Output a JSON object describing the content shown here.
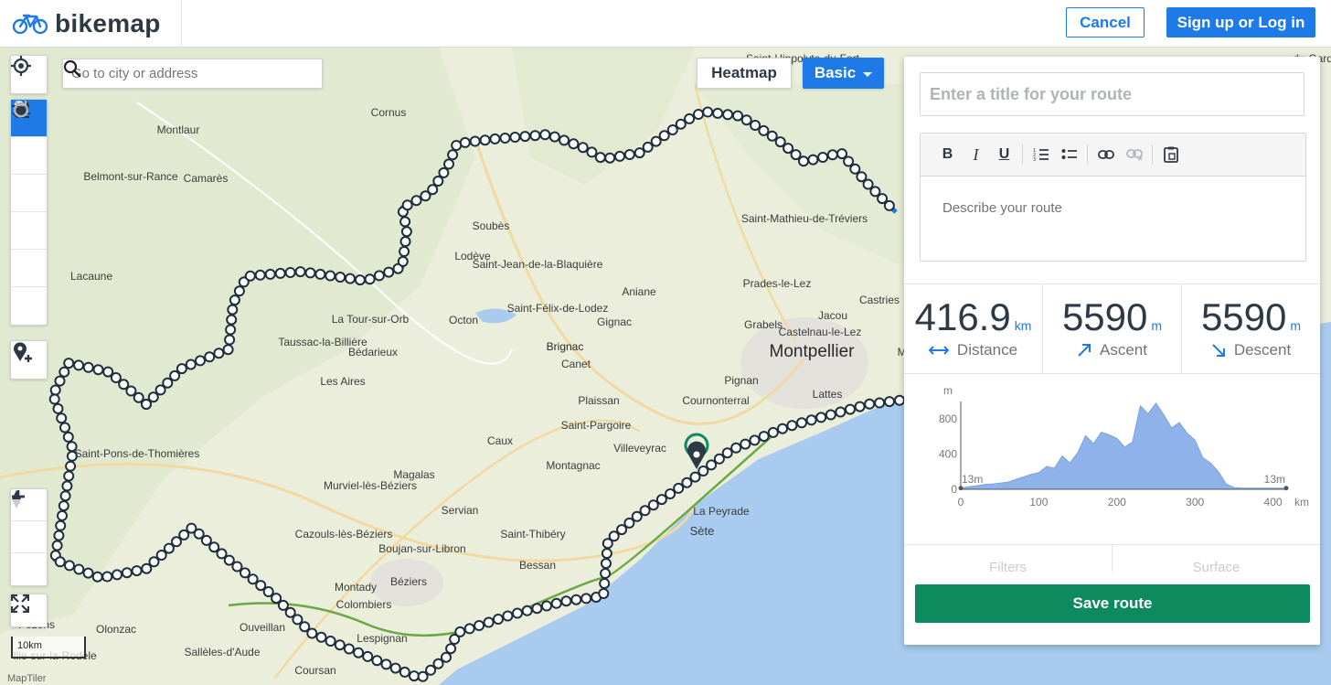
{
  "app": {
    "name": "bikemap"
  },
  "header": {
    "cancel_label": "Cancel",
    "signup_label": "Sign up or Log in"
  },
  "search": {
    "placeholder": "Go to city or address"
  },
  "map_layers": {
    "heatmap_label": "Heatmap",
    "basic_label": "Basic"
  },
  "map": {
    "scale_label": "10km",
    "attribution": "MapTiler",
    "places": [
      "Saint-Hippolyte-du-Fort",
      "Cornus",
      "Montlaur",
      "Belmont-sur-Rance",
      "Camarès",
      "Soubès",
      "Lodève",
      "Saint-Jean-de-la-Blaquière",
      "Saint-Mathieu-de-Tréviers",
      "Lacaune",
      "Prades-le-Lez",
      "Castries",
      "Aniane",
      "Saint-Félix-de-Lodez",
      "La Tour-sur-Orb",
      "Octon",
      "Gignac",
      "Jacou",
      "Grabels",
      "Castelnau-le-Lez",
      "Taussac-la-Billière",
      "Bédarieux",
      "Brignac",
      "Montpellier",
      "Maugu",
      "Canet",
      "Les Aires",
      "Pignan",
      "Lattes",
      "Plaissan",
      "Cournonterral",
      "Saint-Pargoire",
      "Caux",
      "Saint-Pons-de-Thomières",
      "Villeveyrac",
      "Montagnac",
      "Magalas",
      "Murviel-lès-Béziers",
      "Servian",
      "La Peyrade",
      "Sète",
      "Cazouls-lès-Béziers",
      "Saint-Thibéry",
      "Boujan-sur-Libron",
      "Bessan",
      "Béziers",
      "Montady",
      "Colombiers",
      "Olonzac",
      "Ouveillan",
      "Lespignan",
      "Sallèles-d'Aude",
      "Coursan",
      "Pezens",
      "Ille-sur-la-Rodele",
      "du-Gard"
    ]
  },
  "panel": {
    "title_placeholder": "Enter a title for your route",
    "description_placeholder": "Describe your route",
    "stats": [
      {
        "value": "416.9",
        "unit": "km",
        "label": "Distance",
        "icon": "arrows-horizontal-icon"
      },
      {
        "value": "5590",
        "unit": "m",
        "label": "Ascent",
        "icon": "arrow-up-right-icon"
      },
      {
        "value": "5590",
        "unit": "m",
        "label": "Descent",
        "icon": "arrow-down-right-icon"
      }
    ],
    "tabs": [
      "Filters",
      "Surface"
    ],
    "save_label": "Save route"
  },
  "chart_data": {
    "type": "area",
    "title": "",
    "xlabel": "km",
    "ylabel": "m",
    "xlim": [
      0,
      416.9
    ],
    "ylim": [
      0,
      1000
    ],
    "x_ticks": [
      "0",
      "100",
      "200",
      "300",
      "400"
    ],
    "x_unit": "km",
    "y_ticks": [
      "0",
      "400",
      "800"
    ],
    "y_unit": "m",
    "start_label": "13m",
    "end_label": "13m",
    "x": [
      0,
      10,
      20,
      30,
      40,
      50,
      60,
      70,
      80,
      90,
      100,
      110,
      120,
      130,
      140,
      150,
      160,
      170,
      180,
      190,
      200,
      210,
      220,
      230,
      240,
      250,
      260,
      270,
      280,
      290,
      300,
      310,
      320,
      330,
      340,
      350,
      360,
      370,
      380,
      390,
      400,
      416.9
    ],
    "values": [
      13,
      30,
      40,
      55,
      60,
      70,
      80,
      110,
      140,
      170,
      190,
      260,
      240,
      380,
      300,
      420,
      610,
      520,
      650,
      620,
      580,
      480,
      540,
      950,
      860,
      980,
      850,
      700,
      760,
      640,
      560,
      360,
      300,
      200,
      60,
      20,
      15,
      13,
      13,
      13,
      13,
      13
    ],
    "grid": false,
    "color": "#8fb2ea"
  },
  "colors": {
    "accent": "#1d7ae6",
    "save": "#0e8a5f",
    "route": "#1d7ae6",
    "water": "#a9cbef",
    "land": "#eef0e6"
  }
}
